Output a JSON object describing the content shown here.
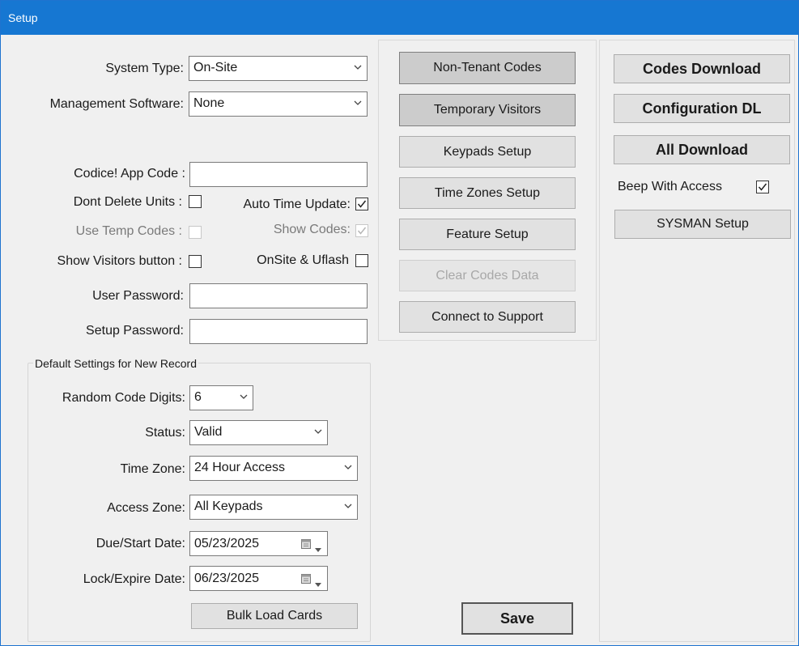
{
  "window": {
    "title": "Setup"
  },
  "left": {
    "system_type": {
      "label": "System Type:",
      "value": "On-Site"
    },
    "management_software": {
      "label": "Management Software:",
      "value": "None"
    },
    "codice_app_code": {
      "label": "Codice! App Code :",
      "value": ""
    },
    "dont_delete_units": {
      "label": "Dont Delete Units :",
      "checked": false
    },
    "auto_time_update": {
      "label": "Auto Time Update:",
      "checked": true
    },
    "use_temp_codes": {
      "label": "Use Temp Codes :",
      "checked": false,
      "enabled": false
    },
    "show_codes": {
      "label": "Show Codes:",
      "checked": true,
      "enabled": false
    },
    "show_visitors_button": {
      "label": "Show Visitors button :",
      "checked": false
    },
    "onsite_uflash": {
      "label": "OnSite & Uflash",
      "checked": false
    },
    "user_password": {
      "label": "User Password:",
      "value": ""
    },
    "setup_password": {
      "label": "Setup Password:",
      "value": ""
    }
  },
  "defaults": {
    "group_title": "Default Settings for New Record",
    "random_code_digits": {
      "label": "Random Code Digits:",
      "value": "6"
    },
    "status": {
      "label": "Status:",
      "value": "Valid"
    },
    "time_zone": {
      "label": "Time Zone:",
      "value": "24 Hour Access"
    },
    "access_zone": {
      "label": "Access Zone:",
      "value": "All Keypads"
    },
    "due_start_date": {
      "label": "Due/Start Date:",
      "value": "05/23/2025"
    },
    "lock_expire_date": {
      "label": "Lock/Expire Date:",
      "value": "06/23/2025"
    },
    "bulk_load_label": "Bulk Load Cards"
  },
  "middle": {
    "non_tenant_codes": "Non-Tenant Codes",
    "temporary_visitors": "Temporary Visitors",
    "keypads_setup": "Keypads Setup",
    "time_zones_setup": "Time Zones Setup",
    "feature_setup": "Feature Setup",
    "clear_codes_data": "Clear Codes Data",
    "connect_to_support": "Connect to Support",
    "save": "Save"
  },
  "right": {
    "codes_download": "Codes Download",
    "configuration_dl": "Configuration DL",
    "all_download": "All Download",
    "beep_with_access": {
      "label": "Beep With Access",
      "checked": true
    },
    "sysman_setup": "SYSMAN Setup"
  },
  "colors": {
    "titlebar": "#1677d2",
    "window_bg": "#f0f0f0",
    "button_bg": "#e1e1e1",
    "disabled_text": "#a8a8a8"
  }
}
